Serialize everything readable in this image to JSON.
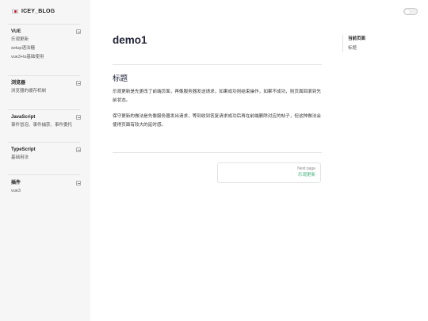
{
  "site": {
    "title": "ICEY_BLOG"
  },
  "sidebar": {
    "groups": [
      {
        "title": "VUE",
        "items": [
          "乐观更新",
          "setup语法糖",
          "vue3+ts基础使用"
        ]
      },
      {
        "title": "浏览器",
        "items": [
          "浏览器的缓存机制"
        ]
      },
      {
        "title": "JavaScript",
        "items": [
          "事件冒泡、事件捕获、事件委托"
        ]
      },
      {
        "title": "TypeScript",
        "items": [
          "基础用法"
        ]
      },
      {
        "title": "插件",
        "items": [
          "vue3"
        ]
      }
    ]
  },
  "main": {
    "title": "demo1",
    "section_heading": "标题",
    "paragraphs": [
      "乐观更新是先更改了前端页面，再像服务器发送请求，如果成功则结束操作，如果不成功，则页面回滚到先前状态。",
      "保守更新的做法是先像服务器发出请求，等到收到答复请求成功后再在前端删除对应的帖子，但这种做法会使得页面有较大的延时感。"
    ],
    "next": {
      "desc": "Next page",
      "link": "乐观更新"
    }
  },
  "outline": {
    "title": "当前页面",
    "items": [
      "标题"
    ]
  },
  "colors": {
    "accent": "#3eaf7c",
    "sidebar_bg": "#f6f6f7"
  }
}
